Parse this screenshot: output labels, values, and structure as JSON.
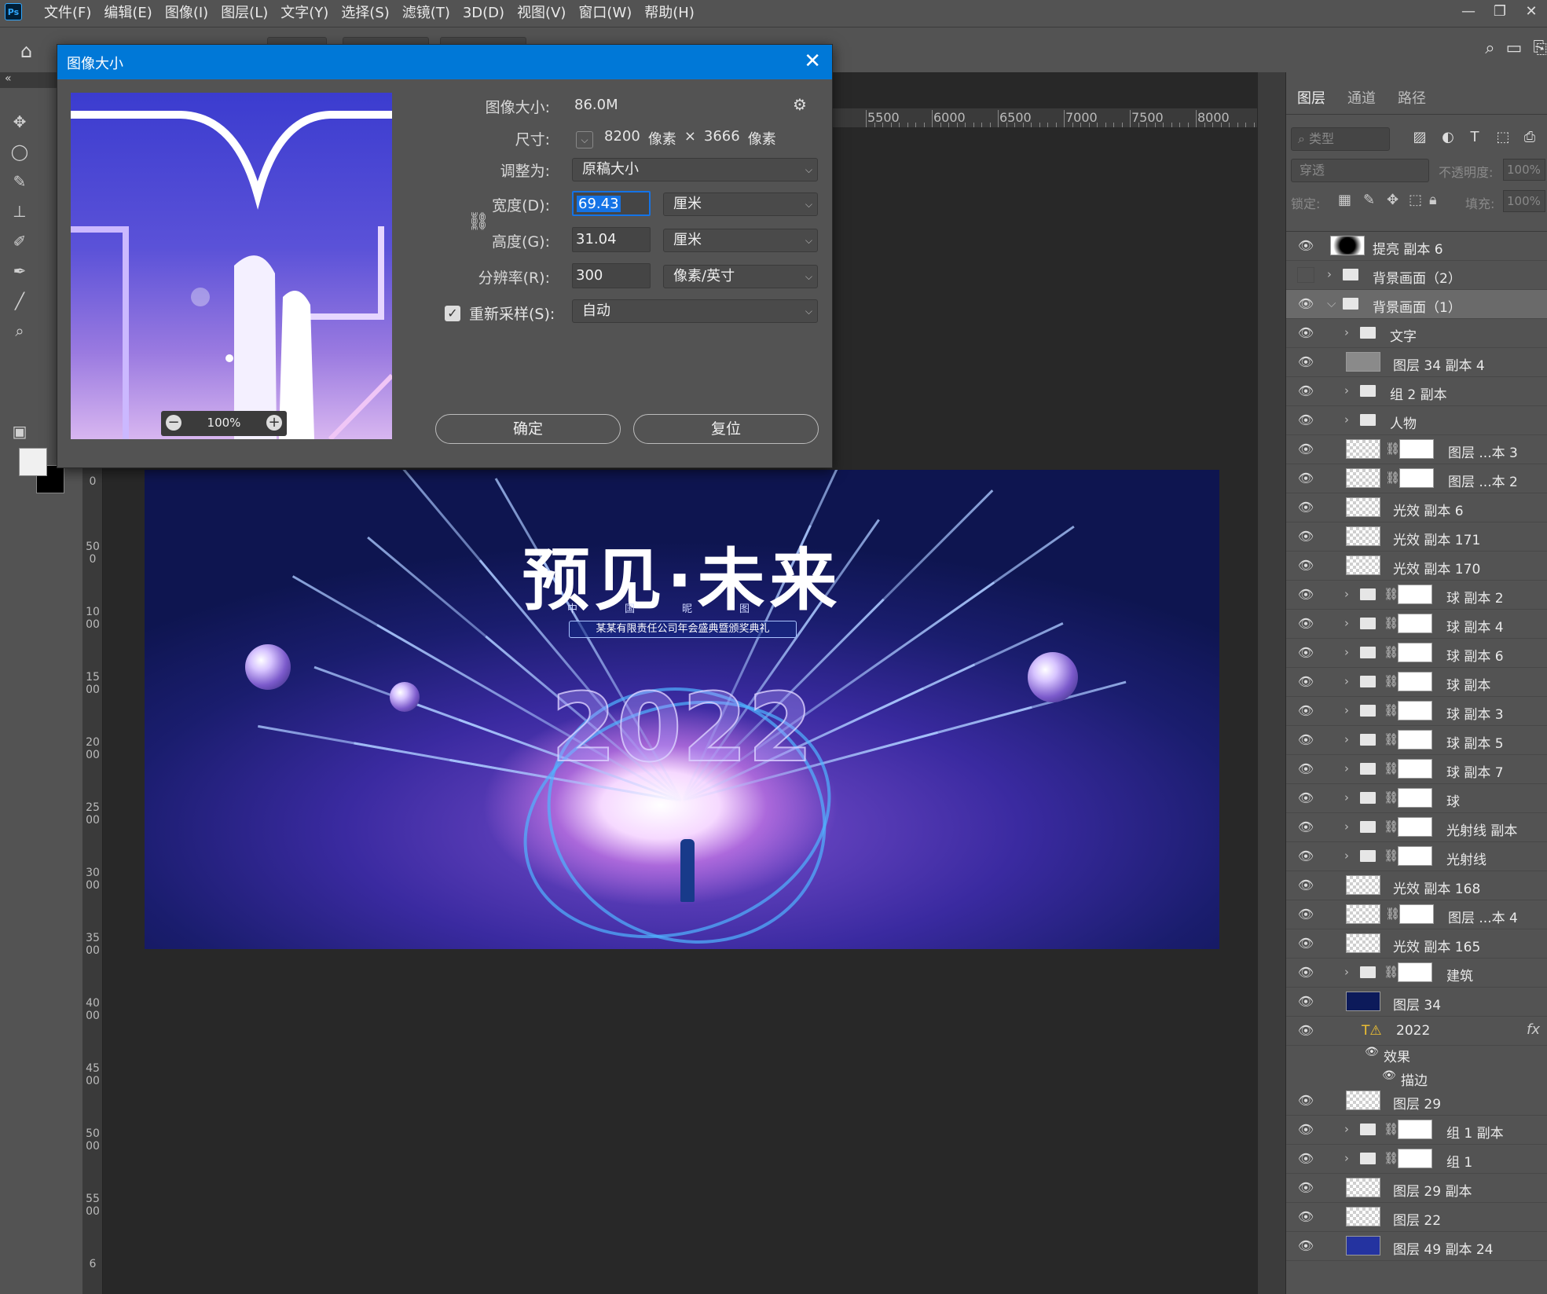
{
  "app": {
    "logo": "Ps"
  },
  "menu": [
    "文件(F)",
    "编辑(E)",
    "图像(I)",
    "图层(L)",
    "文字(Y)",
    "选择(S)",
    "滤镜(T)",
    "3D(D)",
    "视图(V)",
    "窗口(W)",
    "帮助(H)"
  ],
  "window_controls": [
    "—",
    "❐",
    "✕"
  ],
  "ruler": {
    "horizontal": [
      "5500",
      "6000",
      "6500",
      "7000",
      "7500",
      "8000"
    ],
    "vertical": [
      "0",
      "500",
      "1000",
      "1500",
      "2000",
      "2500",
      "3000",
      "3500",
      "4000",
      "4500",
      "5000",
      "5500",
      "6"
    ]
  },
  "poster": {
    "title": "预见·未来",
    "subtitle": "中国昵图",
    "banner": "某某有限责任公司年会盛典暨颁奖典礼",
    "year": "2022"
  },
  "dialog": {
    "title": "图像大小",
    "image_size_label": "图像大小:",
    "image_size_value": "86.0M",
    "dimensions_label": "尺寸:",
    "dim_w": "8200",
    "dim_unit1": "像素",
    "dim_x": "×",
    "dim_h": "3666",
    "dim_unit2": "像素",
    "fit_label": "调整为:",
    "fit_value": "原稿大小",
    "width_label": "宽度(D):",
    "width_value": "69.43",
    "width_unit": "厘米",
    "height_label": "高度(G):",
    "height_value": "31.04",
    "height_unit": "厘米",
    "resolution_label": "分辨率(R):",
    "resolution_value": "300",
    "resolution_unit": "像素/英寸",
    "resample_label": "重新采样(S):",
    "resample_value": "自动",
    "ok_label": "确定",
    "reset_label": "复位",
    "zoom_value": "100%"
  },
  "layers_panel": {
    "tabs": [
      "图层",
      "通道",
      "路径"
    ],
    "kind_placeholder": "类型",
    "blend_mode": "穿透",
    "opacity_label": "不透明度:",
    "opacity_value": "100%",
    "lock_label": "锁定:",
    "fill_label": "填充:",
    "fill_value": "100%",
    "layers": [
      {
        "name": "提亮 副本 6",
        "kind": "layer",
        "visible": true
      },
      {
        "name": "背景画面（2）",
        "kind": "group",
        "visible": false
      },
      {
        "name": "背景画面（1）",
        "kind": "group-open",
        "visible": true
      },
      {
        "name": "文字",
        "kind": "group",
        "visible": true
      },
      {
        "name": "图层 34 副本 4",
        "kind": "layer",
        "visible": true
      },
      {
        "name": "组 2 副本",
        "kind": "group",
        "visible": true
      },
      {
        "name": "人物",
        "kind": "group",
        "visible": true
      },
      {
        "name": "图层 ...本 3",
        "kind": "masked",
        "visible": true
      },
      {
        "name": "图层 ...本 2",
        "kind": "masked",
        "visible": true
      },
      {
        "name": "光效 副本 6",
        "kind": "layer",
        "visible": true
      },
      {
        "name": "光效 副本 171",
        "kind": "layer",
        "visible": true
      },
      {
        "name": "光效 副本 170",
        "kind": "layer",
        "visible": true
      },
      {
        "name": "球 副本 2",
        "kind": "group-mask",
        "visible": true
      },
      {
        "name": "球 副本 4",
        "kind": "group-mask",
        "visible": true
      },
      {
        "name": "球 副本 6",
        "kind": "group-mask",
        "visible": true
      },
      {
        "name": "球 副本",
        "kind": "group-mask",
        "visible": true
      },
      {
        "name": "球 副本 3",
        "kind": "group-mask",
        "visible": true
      },
      {
        "name": "球 副本 5",
        "kind": "group-mask",
        "visible": true
      },
      {
        "name": "球 副本 7",
        "kind": "group-mask",
        "visible": true
      },
      {
        "name": "球",
        "kind": "group-mask",
        "visible": true
      },
      {
        "name": "光射线 副本",
        "kind": "group-mask",
        "visible": true
      },
      {
        "name": "光射线",
        "kind": "group-mask",
        "visible": true
      },
      {
        "name": "光效 副本 168",
        "kind": "layer",
        "visible": true
      },
      {
        "name": "图层 ...本 4",
        "kind": "masked",
        "visible": true
      },
      {
        "name": "光效 副本 165",
        "kind": "layer",
        "visible": true
      },
      {
        "name": "建筑",
        "kind": "group-mask",
        "visible": true
      },
      {
        "name": "图层 34",
        "kind": "layer",
        "visible": true
      },
      {
        "name": "2022",
        "kind": "text",
        "visible": true
      },
      {
        "name": "效果",
        "kind": "effects",
        "visible": true
      },
      {
        "name": "描边",
        "kind": "effect",
        "visible": true
      },
      {
        "name": "图层 29",
        "kind": "layer",
        "visible": true
      },
      {
        "name": "组 1 副本",
        "kind": "group-mask",
        "visible": true
      },
      {
        "name": "组 1",
        "kind": "group-mask",
        "visible": true
      },
      {
        "name": "图层 29 副本",
        "kind": "layer",
        "visible": true
      },
      {
        "name": "图层 22",
        "kind": "layer",
        "visible": true
      },
      {
        "name": "图层 49 副本 24",
        "kind": "layer",
        "visible": true
      }
    ]
  }
}
